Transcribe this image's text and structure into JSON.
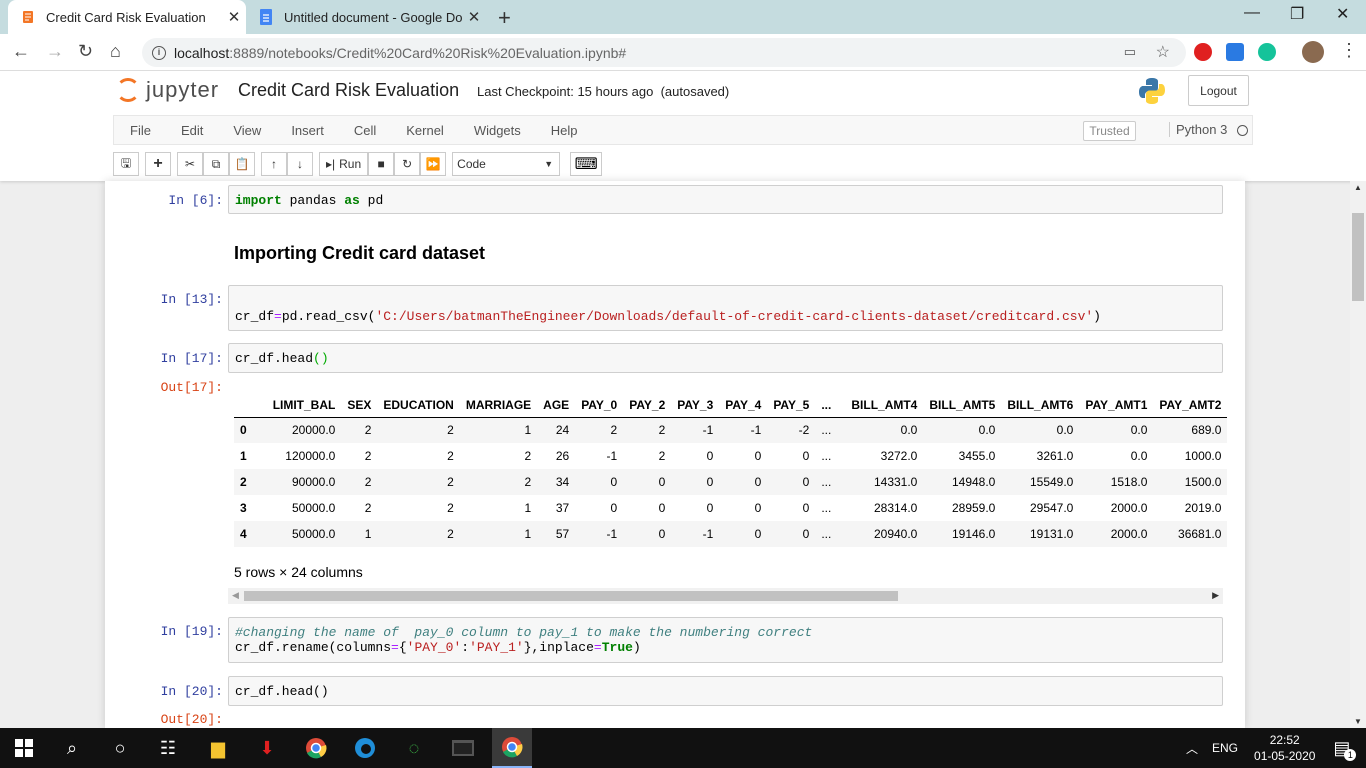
{
  "browser": {
    "tabs": [
      {
        "title": "Credit Card Risk Evaluation",
        "active": true
      },
      {
        "title": "Untitled document - Google Doc",
        "active": false
      }
    ],
    "url_host": "localhost",
    "url_path": ":8889/notebooks/Credit%20Card%20Risk%20Evaluation.ipynb#"
  },
  "jupyter": {
    "logo_text": "jupyter",
    "notebook_title": "Credit Card Risk Evaluation",
    "checkpoint": "Last Checkpoint: 15 hours ago",
    "autosaved": "(autosaved)",
    "logout_label": "Logout",
    "menu": [
      "File",
      "Edit",
      "View",
      "Insert",
      "Cell",
      "Kernel",
      "Widgets",
      "Help"
    ],
    "trusted_label": "Trusted",
    "kernel_name": "Python 3",
    "run_label": "Run",
    "cell_type": "Code"
  },
  "cells": {
    "c6_prompt": "In [6]:",
    "heading": "Importing Credit card dataset",
    "c13_prompt": "In [13]:",
    "c13_var": "cr_df",
    "c13_func": "pd.read_csv(",
    "c13_path": "'C:/Users/batmanTheEngineer/Downloads/default-of-credit-card-clients-dataset/creditcard.csv'",
    "c17_prompt": "In [17]:",
    "c17_out_prompt": "Out[17]:",
    "c19_prompt": "In [19]:",
    "c19_comment": "#changing the name of  pay_0 column to pay_1 to make the numbering correct",
    "c20_prompt": "In [20]:",
    "c20_out_prompt": "Out[20]:",
    "rows_cols": "5 rows × 24 columns"
  },
  "dataframe": {
    "columns": [
      "",
      "LIMIT_BAL",
      "SEX",
      "EDUCATION",
      "MARRIAGE",
      "AGE",
      "PAY_0",
      "PAY_2",
      "PAY_3",
      "PAY_4",
      "PAY_5",
      "...",
      "BILL_AMT4",
      "BILL_AMT5",
      "BILL_AMT6",
      "PAY_AMT1",
      "PAY_AMT2"
    ],
    "rows": [
      [
        "0",
        "20000.0",
        "2",
        "2",
        "1",
        "24",
        "2",
        "2",
        "-1",
        "-1",
        "-2",
        "...",
        "0.0",
        "0.0",
        "0.0",
        "0.0",
        "689.0"
      ],
      [
        "1",
        "120000.0",
        "2",
        "2",
        "2",
        "26",
        "-1",
        "2",
        "0",
        "0",
        "0",
        "...",
        "3272.0",
        "3455.0",
        "3261.0",
        "0.0",
        "1000.0"
      ],
      [
        "2",
        "90000.0",
        "2",
        "2",
        "2",
        "34",
        "0",
        "0",
        "0",
        "0",
        "0",
        "...",
        "14331.0",
        "14948.0",
        "15549.0",
        "1518.0",
        "1500.0"
      ],
      [
        "3",
        "50000.0",
        "2",
        "2",
        "1",
        "37",
        "0",
        "0",
        "0",
        "0",
        "0",
        "...",
        "28314.0",
        "28959.0",
        "29547.0",
        "2000.0",
        "2019.0"
      ],
      [
        "4",
        "50000.0",
        "1",
        "2",
        "1",
        "57",
        "-1",
        "0",
        "-1",
        "0",
        "0",
        "...",
        "20940.0",
        "19146.0",
        "19131.0",
        "2000.0",
        "36681.0"
      ]
    ]
  },
  "taskbar": {
    "lang": "ENG",
    "time": "22:52",
    "date": "01-05-2020",
    "notif_count": "1"
  }
}
